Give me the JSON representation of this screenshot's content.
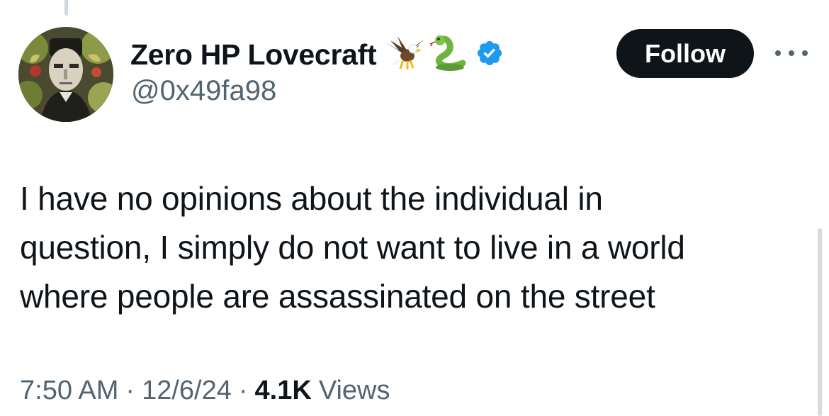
{
  "tweet": {
    "author": {
      "display_name": "Zero HP Lovecraft",
      "handle": "@0x49fa98",
      "name_emojis": [
        "eagle-emoji",
        "snake-emoji"
      ],
      "verified": true,
      "verified_color": "#1d9bf0"
    },
    "follow_label": "Follow",
    "text": "I have no opinions about the individual in\nquestion, I simply do not want to live in a world\nwhere people are assassinated on the street",
    "time": "7:50 AM",
    "date": "12/6/24",
    "separator": "·",
    "views_count": "4.1K",
    "views_label": "Views"
  },
  "icons": {
    "more": "more-horizontal-icon",
    "verified": "verified-badge-icon"
  },
  "colors": {
    "text_primary": "#0f1419",
    "text_secondary": "#536471",
    "follow_bg": "#0f1419",
    "follow_text": "#ffffff"
  }
}
